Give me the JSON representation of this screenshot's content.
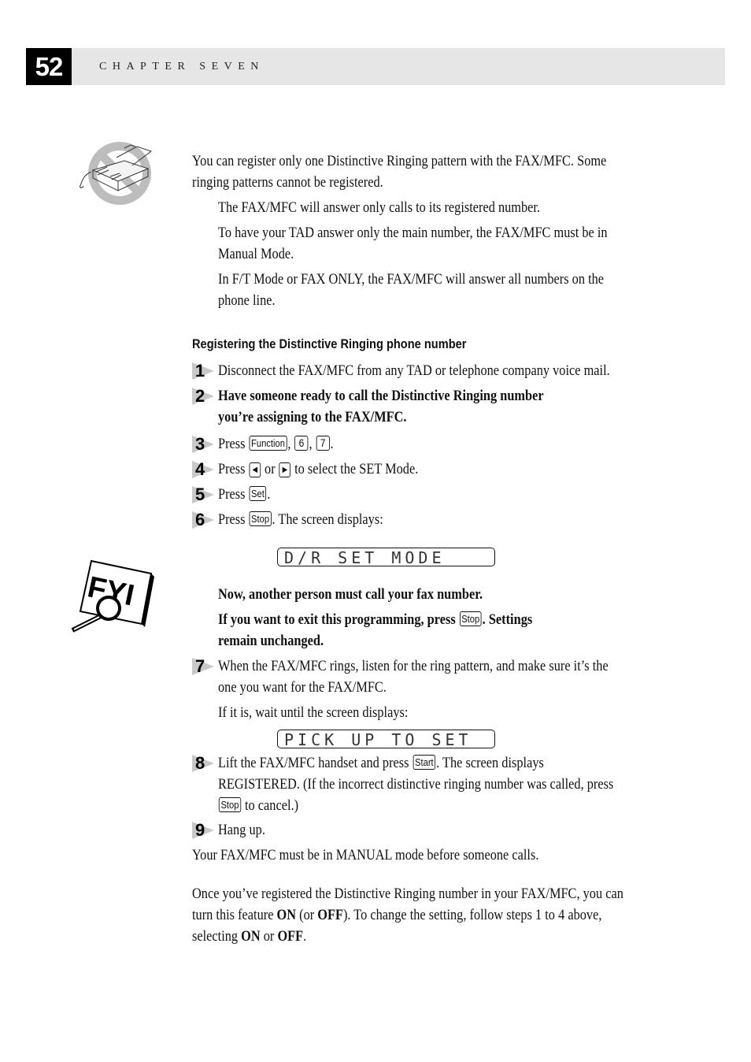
{
  "header": {
    "page_number": "52",
    "chapter": "CHAPTER SEVEN"
  },
  "icons": {
    "fax": "fax-machine-prohibited-icon",
    "fyi": "fyi-magnifier-icon"
  },
  "intro": {
    "para1_line1": "You can register only one Distinctive Ringing pattern with the FAX/MFC. Some",
    "para1_line2": "ringing patterns cannot be registered.",
    "note1": "The FAX/MFC will answer only calls to its registered number.",
    "note2_line1": "To have your TAD answer only the main number, the FAX/MFC must be in",
    "note2_line2": "Manual Mode.",
    "note3_line1": "In F/T Mode or FAX ONLY, the FAX/MFC will answer all numbers on the",
    "note3_line2": "phone line."
  },
  "section": {
    "title": "Registering the Distinctive Ringing phone number"
  },
  "steps": [
    {
      "num": "1",
      "text": "Disconnect the FAX/MFC from any TAD or telephone company voice mail."
    },
    {
      "num": "2",
      "line1": "Have someone ready to call the Distinctive Ringing number",
      "line2": "you’re assigning to the FAX/MFC."
    },
    {
      "num": "3",
      "prefix": "Press",
      "keys": [
        "Function",
        "6",
        "7"
      ],
      "sep": ",",
      "suffix": "."
    },
    {
      "num": "4",
      "prefix": "Press",
      "key_left": "◀",
      "mid": "or",
      "key_right": "▶",
      "suffix": "to select the SET Mode."
    },
    {
      "num": "5",
      "prefix": "Press",
      "key": "Set",
      "suffix": "."
    },
    {
      "num": "6",
      "prefix": "Press",
      "key": "Stop",
      "suffix": ". The screen displays:"
    },
    {
      "num": "7",
      "line1": "When the FAX/MFC rings, listen for the ring pattern, and make sure it’s the",
      "line2": "one you want for the FAX/MFC.",
      "followup": "If it is, wait until the screen displays:"
    },
    {
      "num": "8",
      "line1_prefix": "Lift the FAX/MFC handset and press",
      "key": "Start",
      "line1_suffix": ".  The screen displays",
      "line2": "REGISTERED.  (If the incorrect distinctive ringing number was called, press",
      "line3_key": "Stop",
      "line3_suffix": "to cancel.)"
    },
    {
      "num": "9",
      "text": "Hang up."
    }
  ],
  "lcd": {
    "display1": "D/R SET MODE",
    "display2": "PICK UP TO SET"
  },
  "fyi_notes": {
    "note1": "Now, another person must call your fax number.",
    "note2_prefix": "If you want to exit this programming, press",
    "note2_key": "Stop",
    "note2_suffix": ".  Settings",
    "note2_line2": "remain unchanged."
  },
  "footer": {
    "manual_note": "Your FAX/MFC must be in MANUAL mode before someone calls.",
    "closing_line1": "Once you’ve registered the Distinctive Ringing number in your FAX/MFC, you can",
    "closing_line2_a": "turn this feature",
    "on": "ON",
    "closing_line2_b": "(or",
    "off": "OFF",
    "closing_line2_c": ").  To change the setting, follow steps 1 to 4 above,",
    "closing_line3_a": "selecting",
    "closing_line3_b": "or",
    "closing_line3_c": "."
  }
}
